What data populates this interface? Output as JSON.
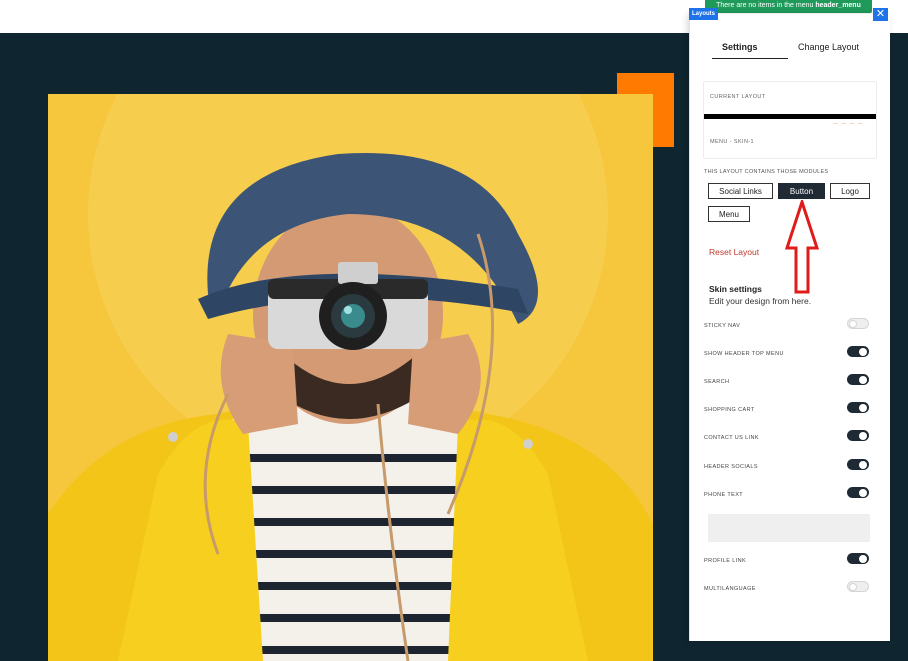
{
  "notice": {
    "text": "There are no items in the menu ",
    "menu_name": "header_menu"
  },
  "panel": {
    "tag": "Layouts",
    "close_icon": "close-icon",
    "tabs": [
      {
        "label": "Settings",
        "active": true
      },
      {
        "label": "Change Layout",
        "active": false
      }
    ],
    "current_layout_label": "CURRENT LAYOUT",
    "current_layout_name": "MENU - SKIN-1",
    "modules_caption": "THIS LAYOUT CONTAINS THOSE MODULES",
    "modules": [
      {
        "label": "Social Links",
        "selected": false
      },
      {
        "label": "Button",
        "selected": true
      },
      {
        "label": "Logo",
        "selected": false
      },
      {
        "label": "Menu",
        "selected": false
      }
    ],
    "reset_label": "Reset Layout",
    "skin_title": "Skin settings",
    "skin_subtitle": "Edit your design from here.",
    "settings": [
      {
        "label": "STICKY NAV",
        "on": false
      },
      {
        "label": "SHOW HEADER TOP MENU",
        "on": true
      },
      {
        "label": "SEARCH",
        "on": true
      },
      {
        "label": "SHOPPING CART",
        "on": true
      },
      {
        "label": "CONTACT US LINK",
        "on": true
      },
      {
        "label": "HEADER SOCIALS",
        "on": true
      },
      {
        "label": "PHONE TEXT",
        "on": true
      },
      {
        "label": "PROFILE LINK",
        "on": true
      },
      {
        "label": "MULTILANGUAGE",
        "on": false
      }
    ],
    "phone_text_value": ""
  },
  "colors": {
    "hero_bg": "#0f2530",
    "accent_orange": "#ff7a00",
    "toggle_on": "#1f2a34",
    "notice_green": "#1f9a5a",
    "tag_blue": "#1f73e8",
    "reset_red": "#c0392b",
    "annotation_arrow": "#e01b1b"
  }
}
